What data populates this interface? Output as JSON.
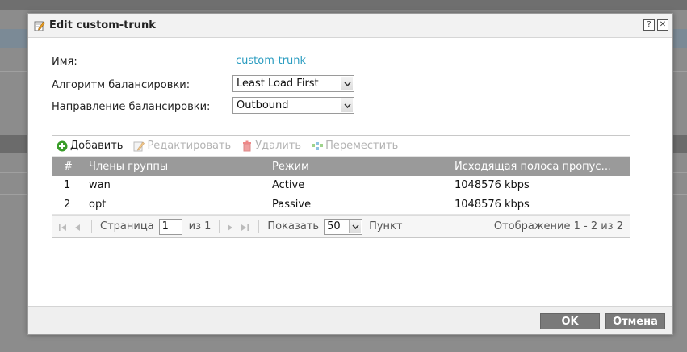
{
  "dialog": {
    "title": "Edit custom-trunk",
    "help_label": "?",
    "close_label": "✕"
  },
  "form": {
    "name_label": "Имя:",
    "name_value": "custom-trunk",
    "algorithm_label": "Алгоритм балансировки:",
    "algorithm_value": "Least Load First",
    "direction_label": "Направление балансировки:",
    "direction_value": "Outbound"
  },
  "toolbar": {
    "add": "Добавить",
    "edit": "Редактировать",
    "delete": "Удалить",
    "move": "Переместить"
  },
  "table": {
    "columns": [
      "#",
      "Члены группы",
      "Режим",
      "Исходящая полоса пропус…"
    ],
    "rows": [
      {
        "num": "1",
        "member": "wan",
        "mode": "Active",
        "bandwidth": "1048576 kbps"
      },
      {
        "num": "2",
        "member": "opt",
        "mode": "Passive",
        "bandwidth": "1048576 kbps"
      }
    ]
  },
  "pager": {
    "page_label": "Страница",
    "page_value": "1",
    "of_label": "из 1",
    "show_label": "Показать",
    "show_value": "50",
    "items_label": "Пункт",
    "display_text": "Отображение 1 - 2 из 2"
  },
  "buttons": {
    "ok": "OK",
    "cancel": "Отмена"
  },
  "colors": {
    "accent_link": "#2a9cc0",
    "header_bg": "#9a9a9a",
    "button_bg": "#7a7a7a",
    "add_icon": "#3a9d2a",
    "delete_icon": "#e07070"
  }
}
